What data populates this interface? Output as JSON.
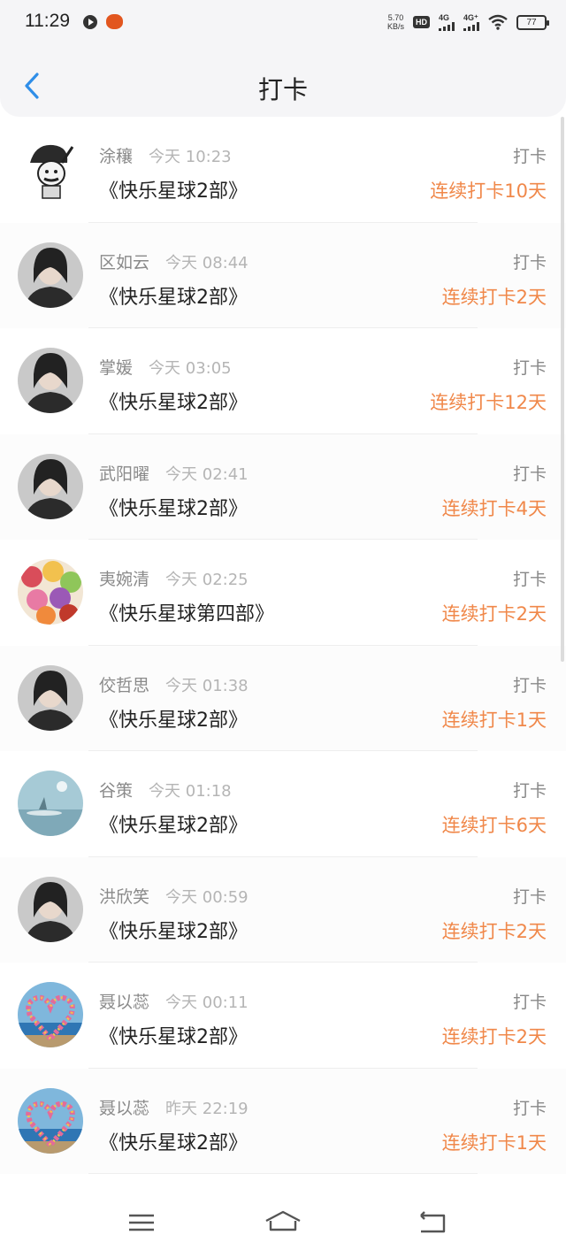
{
  "status_bar": {
    "time": "11:29",
    "net_speed_value": "5.70",
    "net_speed_unit": "KB/s",
    "hd_label": "HD",
    "network_1": "4G",
    "network_2": "4G⁺",
    "battery": "77"
  },
  "header": {
    "title": "打卡"
  },
  "checkins": [
    {
      "name": "涂穰",
      "time": "今天 10:23",
      "book": "《快乐星球2部》",
      "type": "打卡",
      "streak": "连续打卡10天",
      "avatar": "avatar-cartoon"
    },
    {
      "name": "区如云",
      "time": "今天 08:44",
      "book": "《快乐星球2部》",
      "type": "打卡",
      "streak": "连续打卡2天",
      "avatar": "avatar-portrait"
    },
    {
      "name": "掌媛",
      "time": "今天 03:05",
      "book": "《快乐星球2部》",
      "type": "打卡",
      "streak": "连续打卡12天",
      "avatar": "avatar-portrait"
    },
    {
      "name": "武阳曜",
      "time": "今天 02:41",
      "book": "《快乐星球2部》",
      "type": "打卡",
      "streak": "连续打卡4天",
      "avatar": "avatar-portrait"
    },
    {
      "name": "夷婉清",
      "time": "今天 02:25",
      "book": "《快乐星球第四部》",
      "type": "打卡",
      "streak": "连续打卡2天",
      "avatar": "avatar-candy"
    },
    {
      "name": "佼哲思",
      "time": "今天 01:38",
      "book": "《快乐星球2部》",
      "type": "打卡",
      "streak": "连续打卡1天",
      "avatar": "avatar-portrait"
    },
    {
      "name": "谷策",
      "time": "今天 01:18",
      "book": "《快乐星球2部》",
      "type": "打卡",
      "streak": "连续打卡6天",
      "avatar": "avatar-landscape"
    },
    {
      "name": "洪欣笑",
      "time": "今天 00:59",
      "book": "《快乐星球2部》",
      "type": "打卡",
      "streak": "连续打卡2天",
      "avatar": "avatar-portrait"
    },
    {
      "name": "聂以蕊",
      "time": "今天 00:11",
      "book": "《快乐星球2部》",
      "type": "打卡",
      "streak": "连续打卡2天",
      "avatar": "avatar-heart"
    },
    {
      "name": "聂以蕊",
      "time": "昨天 22:19",
      "book": "《快乐星球2部》",
      "type": "打卡",
      "streak": "连续打卡1天",
      "avatar": "avatar-heart"
    }
  ],
  "colors": {
    "accent": "#f0884a",
    "back_arrow": "#2f8ee8",
    "header_bg": "#f5f5f7"
  },
  "icons": {
    "back": "chevron-left-icon",
    "nav_menu": "menu-icon",
    "nav_home": "home-icon",
    "nav_back": "return-icon"
  }
}
